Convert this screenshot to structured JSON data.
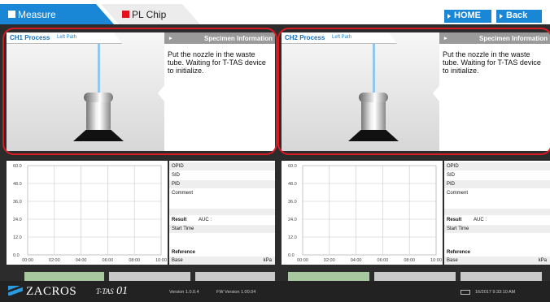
{
  "tabs": [
    {
      "label": "Measure",
      "marker_color": "#ffffff",
      "active": true
    },
    {
      "label": "PL Chip",
      "marker_color": "#e5101e",
      "active": false
    }
  ],
  "nav": {
    "home_label": "HOME",
    "back_label": "Back"
  },
  "channels": [
    {
      "process_title": "CH1 Process",
      "path_label": "Left Path",
      "info_title": "Specimen Information",
      "instruction": "Put the nozzle in the waste tube. Waiting for T-TAS device to initialize.",
      "info": {
        "opid_label": "OPID",
        "sid_label": "SID",
        "pid_label": "PID",
        "comment_label": "Comment",
        "result_label": "Result",
        "auc_label": "AUC",
        "auc_sep": ":",
        "start_time_label": "Start Time",
        "reference_label": "Reference",
        "base_label": "Base",
        "base_unit": "kPa"
      }
    },
    {
      "process_title": "CH2 Process",
      "path_label": "Left Path",
      "info_title": "Specimen Information",
      "instruction": "Put the nozzle in the waste tube. Waiting for T-TAS device to initialize.",
      "info": {
        "opid_label": "OPID",
        "sid_label": "SID",
        "pid_label": "PID",
        "comment_label": "Comment",
        "result_label": "Result",
        "auc_label": "AUC",
        "auc_sep": ":",
        "start_time_label": "Start Time",
        "reference_label": "Reference",
        "base_label": "Base",
        "base_unit": "kPa"
      }
    }
  ],
  "chart_data": [
    {
      "type": "line",
      "title": "",
      "xlabel": "",
      "ylabel": "",
      "x_ticks": [
        "00:00",
        "02:00",
        "04:00",
        "06:00",
        "08:00",
        "10:00"
      ],
      "y_ticks": [
        "0.0",
        "12.0",
        "24.0",
        "36.0",
        "48.0",
        "60.0"
      ],
      "xlim": [
        0,
        10
      ],
      "ylim": [
        0,
        60
      ],
      "grid": true,
      "series": []
    },
    {
      "type": "line",
      "title": "",
      "xlabel": "",
      "ylabel": "",
      "x_ticks": [
        "00:00",
        "02:00",
        "04:00",
        "06:00",
        "08:00",
        "10:00"
      ],
      "y_ticks": [
        "0.0",
        "12.0",
        "24.0",
        "36.0",
        "48.0",
        "60.0"
      ],
      "xlim": [
        0,
        10
      ],
      "ylim": [
        0,
        60
      ],
      "grid": true,
      "series": []
    }
  ],
  "footer": {
    "brand": "ZACROS",
    "product": "T-TAS",
    "product_model": "01",
    "software_version": "Version 1.0.0.4",
    "firmware_version": "FW Version 1.00.04",
    "datetime": "16/2017 9:33:10 AM"
  },
  "colors": {
    "accent": "#1a86d6",
    "highlight": "#d81a22",
    "background": "#2c2c2c"
  }
}
